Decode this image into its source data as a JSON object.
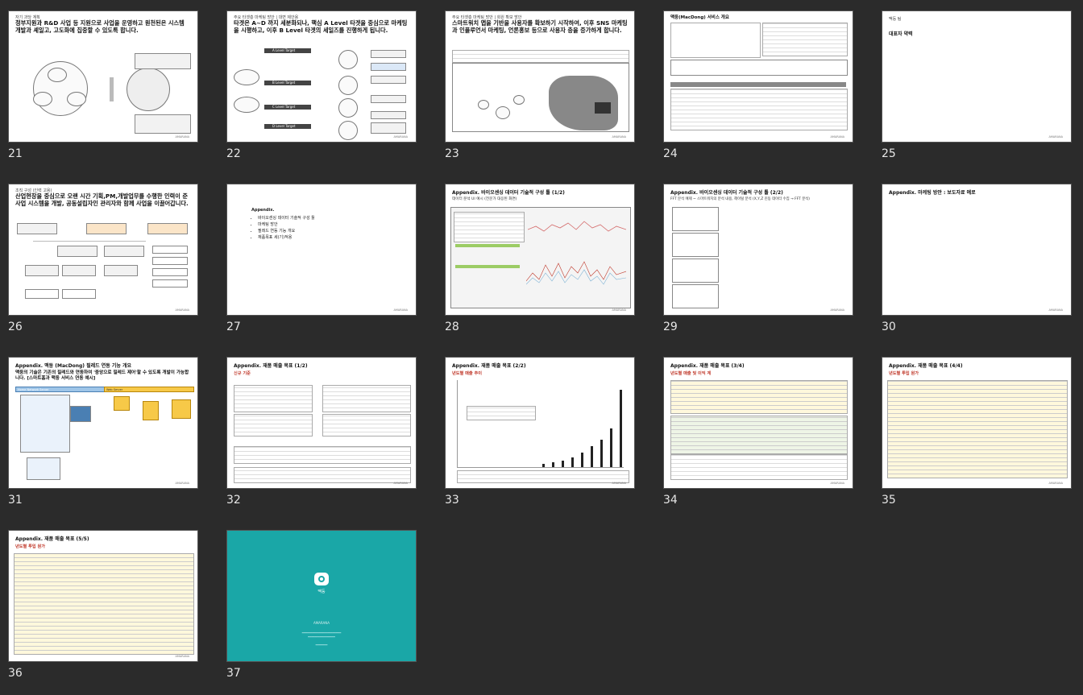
{
  "slides": [
    {
      "num": "21",
      "kicker": "자기 과당 계획",
      "title": "정부지원과 R&D 사업 등 지원으로 사업을 운영하고 원천된은 시스템 개발과 셰일고, 고도화에 집중할 수 있도록 합니다."
    },
    {
      "num": "22",
      "kicker": "주요 타겟층 마케팅 방안 | 대면 제안용",
      "title": "타겟은 A~D 까지 세분화되나, 핵심 A Level 타겟을 중심으로 마케팅을 시행하고, 이후 B Level 타겟의 세일즈를 진행하게 됩니다.",
      "levels": [
        "A Level Target",
        "B Level Target",
        "C Level Target",
        "D Level Target"
      ]
    },
    {
      "num": "23",
      "kicker": "주요 타겟층 마케팅 방안 | 회원 확보 방안",
      "title": "스마트워치 앱을 기반을 사용자를 확보하기 시작하여, 이후 SNS 마케팅과 인플루언서 마케팅, 언론홍보 등으로 사용자 층을 증가하게 합니다."
    },
    {
      "num": "24",
      "kicker": "",
      "title": "맥둥(MacDong) 서비스 개요"
    },
    {
      "num": "25",
      "kicker": "맥둥 팀",
      "title": "대표자 약력"
    },
    {
      "num": "26",
      "kicker": "조직 구성 (인력 고용)",
      "title": "산업현장을 중심으로 오랜 시간 기획,PM,개발업무를 수행한 인력이 준 사업 시스템을 개발, 공동설립자인 관리자와 함께 사업을 이끌어갑니다."
    },
    {
      "num": "27",
      "title": "Appendix.",
      "items": [
        "바이오센싱 데이터 기술적 구성 툴",
        "마케팅 방안",
        "필레드 연동 기능 개요",
        "재품목표 세(기)적용"
      ]
    },
    {
      "num": "28",
      "title": "Appendix. 바이오센싱 데이터 기술적 구성 툴 (1/2)",
      "sub": "데이터 분석 UI 예시 (전문가 대응된 화면)"
    },
    {
      "num": "29",
      "title": "Appendix. 바이오센싱 데이터 기술적 구성 툴 (2/2)",
      "sub": "FFT 분석 예제 ~ 스마트워치의 분석 내용, 헤이털 분석 (X,Y,Z 진동 데이터 수집 → FFT 분석)"
    },
    {
      "num": "30",
      "title": "Appendix. 마케팅 방안 : 보도자료 예로"
    },
    {
      "num": "31",
      "title": "Appendix. 맥둥 (MacDong) 필레드 연동 기능 개요",
      "sub": "맥둥의 기술은 기존의 필레드와 연동하여 '중앙으로 필레드 제어'할 수 있도록 개발이 가능합니다. [스마트홈과 맥둥 서비스 연동 예시]",
      "labels": [
        "Home Network Server",
        "Web Server"
      ]
    },
    {
      "num": "32",
      "title": "Appendix. 재품 매출 목표 (1/2)",
      "sub": "신규 기준"
    },
    {
      "num": "33",
      "title": "Appendix. 재품 매출 목표 (2/2)",
      "sub": "년도별 매출 추이"
    },
    {
      "num": "34",
      "title": "Appendix. 재품 매출 목표 (3/4)",
      "sub": "년도별 매출 및 이익 계"
    },
    {
      "num": "35",
      "title": "Appendix. 재품 매출 목표 (4/4)",
      "sub": "년도별 투입 원가"
    },
    {
      "num": "36",
      "title": "Appendix. 재품 매출 목표 (5/5)",
      "sub": "년도별 투입 원가"
    },
    {
      "num": "37",
      "logo": "맥둥",
      "brand": "AMARANA"
    }
  ],
  "footer_brand": "AMARANA",
  "colors": {
    "background": "#2b2b2b",
    "accent": "#c0392b",
    "teal": "#1aa7a7"
  }
}
